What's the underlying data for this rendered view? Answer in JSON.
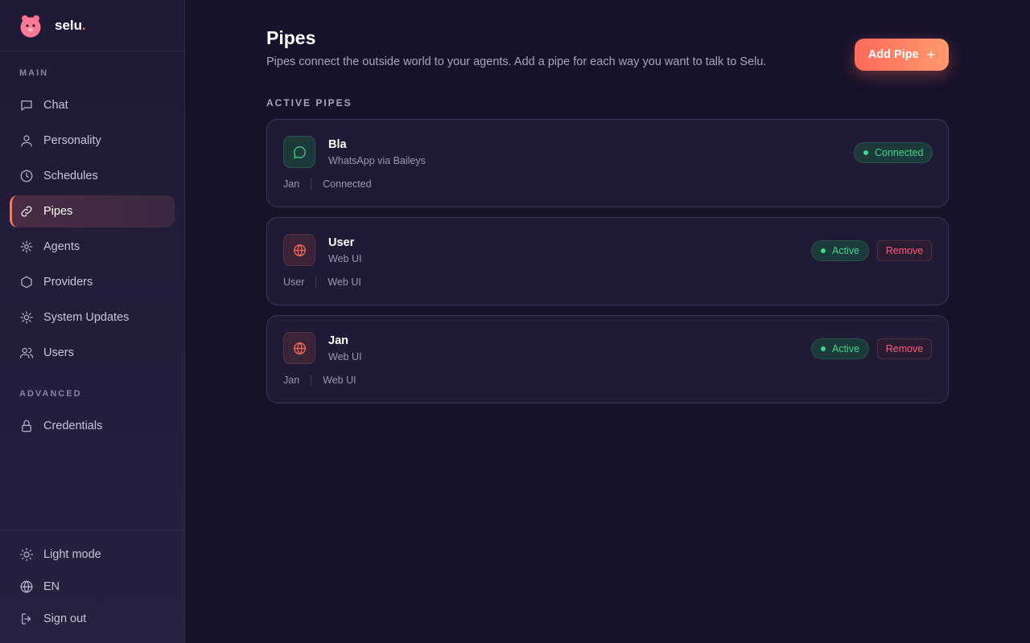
{
  "brand": {
    "name": "selu",
    "dot": "."
  },
  "sidebar": {
    "main_label": "MAIN",
    "advanced_label": "ADVANCED",
    "items": [
      {
        "label": "Chat",
        "icon": "chat-icon"
      },
      {
        "label": "Personality",
        "icon": "user-icon"
      },
      {
        "label": "Schedules",
        "icon": "clock-icon"
      },
      {
        "label": "Pipes",
        "icon": "link-icon"
      },
      {
        "label": "Agents",
        "icon": "agents-icon"
      },
      {
        "label": "Providers",
        "icon": "hexagon-icon"
      },
      {
        "label": "System Updates",
        "icon": "gear-icon"
      },
      {
        "label": "Users",
        "icon": "users-icon"
      }
    ],
    "advanced_items": [
      {
        "label": "Credentials",
        "icon": "lock-icon"
      }
    ],
    "bottom": [
      {
        "label": "Light mode",
        "icon": "sun-icon"
      },
      {
        "label": "EN",
        "icon": "globe-icon"
      },
      {
        "label": "Sign out",
        "icon": "sign-out-icon"
      }
    ]
  },
  "main": {
    "title": "Pipes",
    "subtitle": "Pipes connect the outside world to your agents. Add a pipe for each way you want to talk to Selu.",
    "add_label": "Add Pipe",
    "add_plus": "+",
    "section": "ACTIVE PIPES",
    "pipes": [
      {
        "name": "Bla",
        "type": "WhatsApp via Baileys",
        "owner": "Jan",
        "meta": "Connected",
        "status": "Connected",
        "remove": ""
      },
      {
        "name": "User",
        "type": "Web UI",
        "owner": "User",
        "meta": "Web UI",
        "status": "Active",
        "remove": "Remove"
      },
      {
        "name": "Jan",
        "type": "Web UI",
        "owner": "Jan",
        "meta": "Web UI",
        "status": "Active",
        "remove": "Remove"
      }
    ]
  },
  "colors": {
    "accent": "#ff7a5c",
    "status_green": "#3fd68a",
    "remove_red": "#ff5a7a",
    "background": "#16122a"
  }
}
